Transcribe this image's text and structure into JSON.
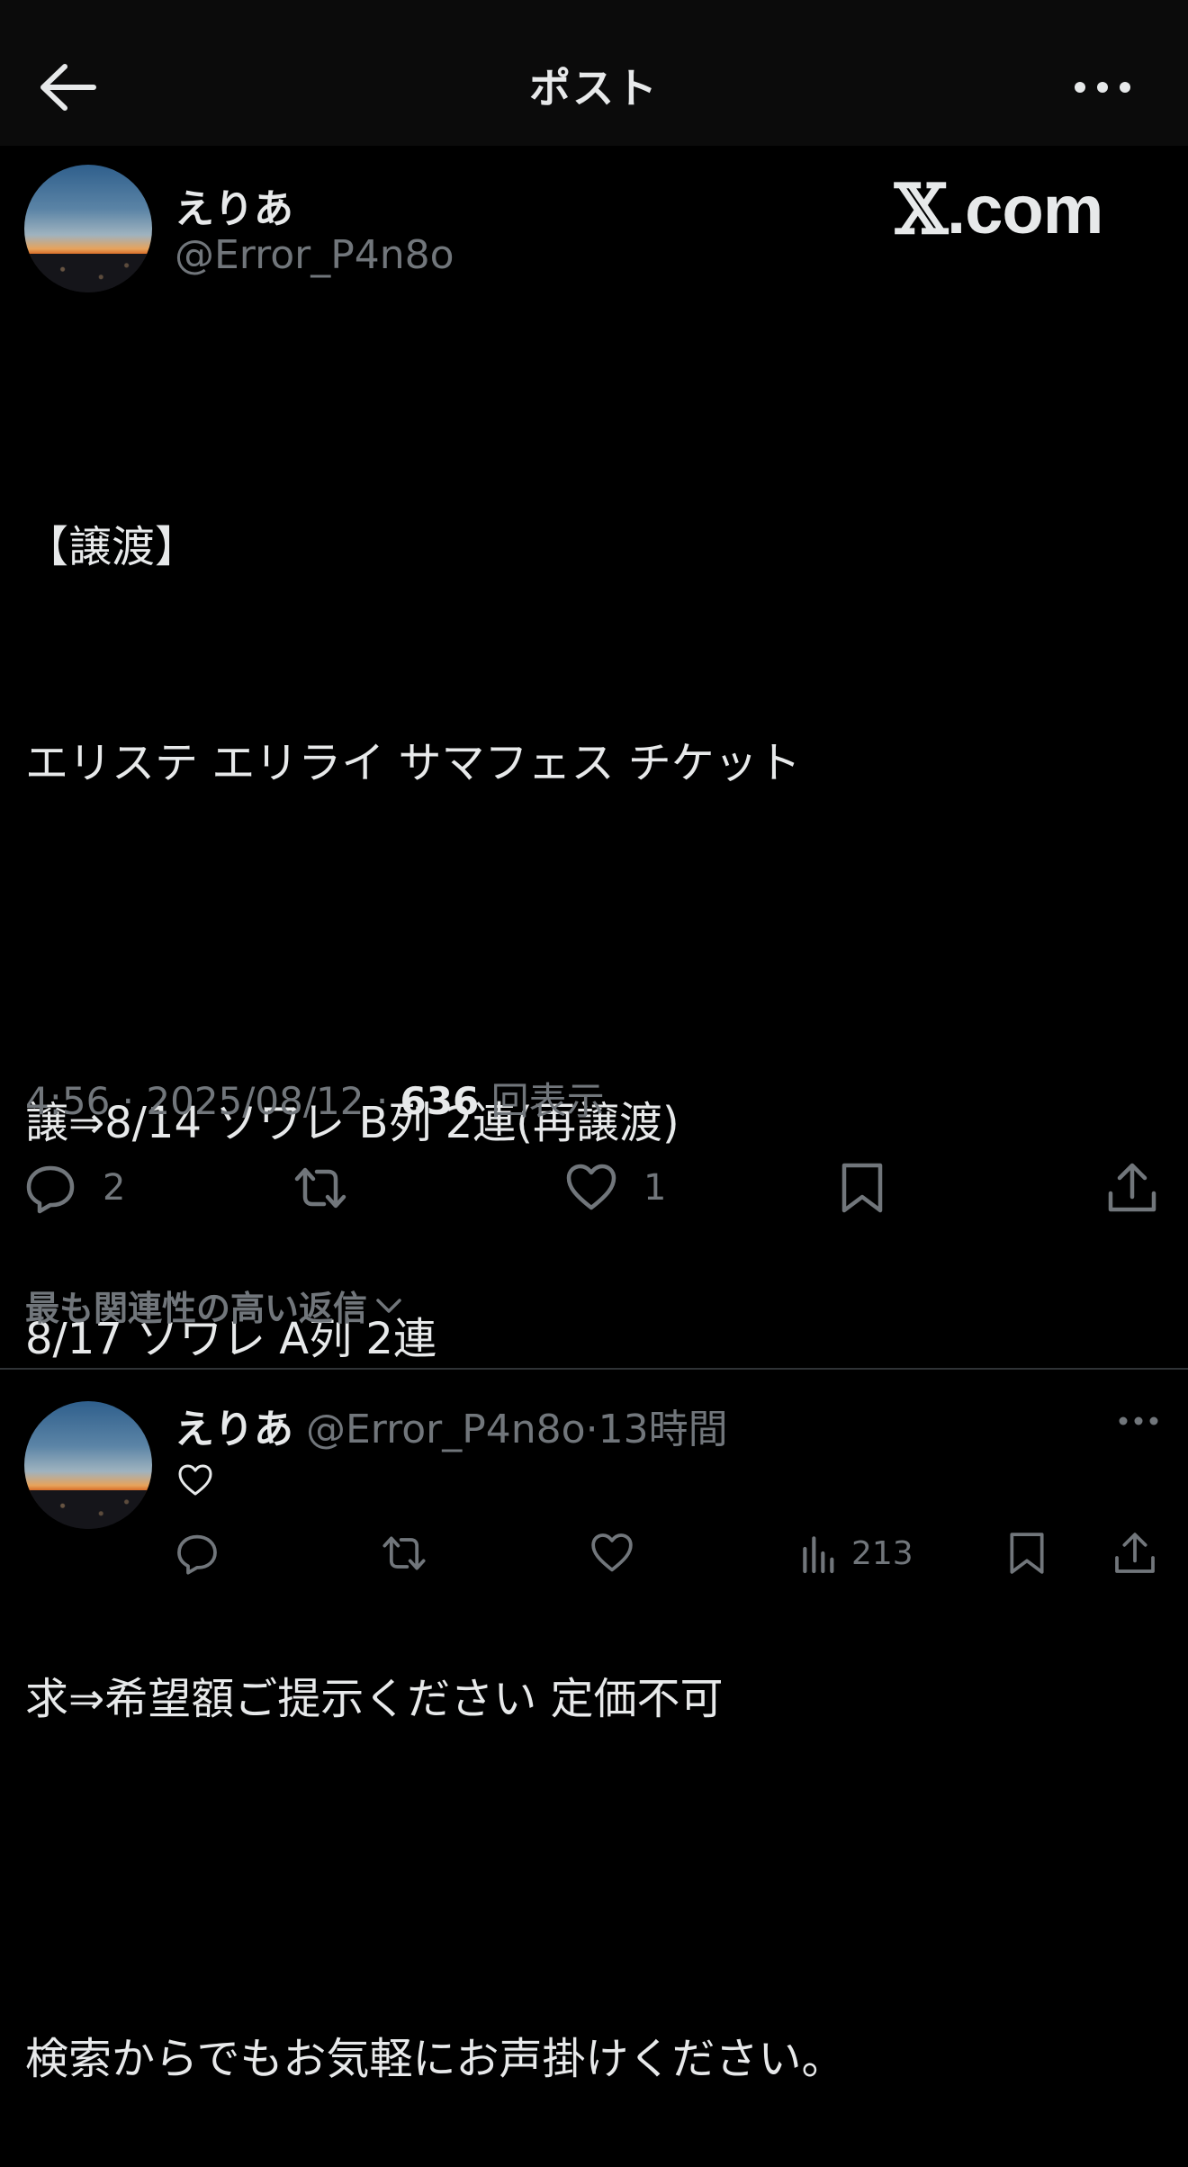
{
  "header": {
    "title": "ポスト"
  },
  "author": {
    "display_name": "えりあ",
    "handle": "@Error_P4n8o"
  },
  "watermark": {
    "x_glyph": "𝕏",
    "domain": ".com"
  },
  "post": {
    "lines": [
      "【譲渡】",
      "エリステ エリライ サマフェス チケット",
      "",
      "譲⇒8/14 ソワレ B列 2連(再譲渡)",
      "8/17 ソワレ A列 2連",
      "",
      "求⇒希望額ご提示ください 定価不可",
      "",
      "検索からでもお気軽にお声掛けください。"
    ],
    "time": "4:56",
    "date": "2025/08/12",
    "views_count": "636",
    "views_label": "回表示",
    "separator": " · "
  },
  "actions": {
    "reply_count": "2",
    "repost_count": "",
    "like_count": "1"
  },
  "replies_sort": {
    "label": "最も関連性の高い返信"
  },
  "reply": {
    "display_name": "えりあ",
    "handle": "@Error_P4n8o",
    "time_ago": "13時間",
    "body_icon": "heart-outline",
    "views": "213"
  },
  "colors": {
    "background": "#000000",
    "header_bg": "#0b0b0b",
    "text": "#e7e9ea",
    "muted": "#71767b",
    "divider": "#2f3336"
  }
}
